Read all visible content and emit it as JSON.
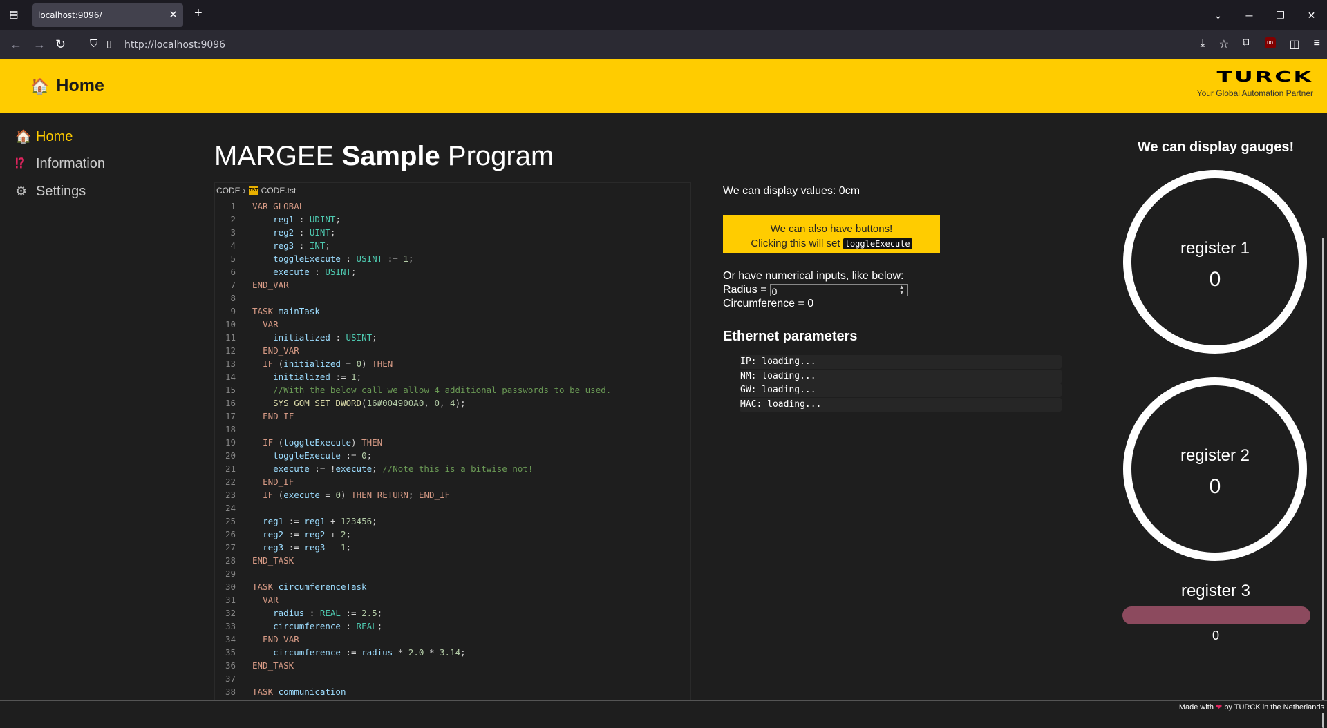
{
  "browser": {
    "tab_title": "localhost:9096/",
    "tab_close": "✕",
    "new_tab": "+",
    "url": "http://localhost:9096"
  },
  "header": {
    "title": "Home",
    "logo_text": "TURCK",
    "logo_tagline": "Your Global Automation Partner"
  },
  "sidebar": {
    "items": [
      {
        "label": "Home",
        "icon": "house-icon",
        "active": true
      },
      {
        "label": "Information",
        "icon": "exclamation-question-icon",
        "active": false
      },
      {
        "label": "Settings",
        "icon": "gear-icon",
        "active": false
      }
    ]
  },
  "page": {
    "title_part1": "MARGEE ",
    "title_bold": "Sample",
    "title_part2": " Program"
  },
  "code": {
    "breadcrumb_folder": "CODE",
    "breadcrumb_file": "CODE.tst",
    "file_icon_text": "TST",
    "lines": [
      "VAR_GLOBAL",
      "    reg1 : UDINT;",
      "    reg2 : UINT;",
      "    reg3 : INT;",
      "    toggleExecute : USINT := 1;",
      "    execute : USINT;",
      "END_VAR",
      "",
      "TASK mainTask",
      "  VAR",
      "    initialized : USINT;",
      "  END_VAR",
      "  IF (initialized = 0) THEN",
      "    initialized := 1;",
      "    //With the below call we allow 4 additional passwords to be used.",
      "    SYS_GOM_SET_DWORD(16#004900A0, 0, 4);",
      "  END_IF",
      "",
      "  IF (toggleExecute) THEN",
      "    toggleExecute := 0;",
      "    execute := !execute; //Note this is a bitwise not!",
      "  END_IF",
      "  IF (execute = 0) THEN RETURN; END_IF",
      "",
      "  reg1 := reg1 + 123456;",
      "  reg2 := reg2 + 2;",
      "  reg3 := reg3 - 1;",
      "END_TASK",
      "",
      "TASK circumferenceTask",
      "  VAR",
      "    radius : REAL := 2.5;",
      "    circumference : REAL;",
      "  END_VAR",
      "    circumference := radius * 2.0 * 3.14;",
      "END_TASK",
      "",
      "TASK communication"
    ]
  },
  "values": {
    "display_text": "We can display values: 0cm",
    "button_line1": "We can also have buttons!",
    "button_line2": "Clicking this will set ",
    "button_code": "toggleExecute",
    "inputs_intro": "Or have numerical inputs, like below:",
    "radius_label": "Radius =",
    "radius_value": "0",
    "circumference_text": "Circumference = 0"
  },
  "ethernet": {
    "title": "Ethernet parameters",
    "rows": [
      "IP: loading...",
      "NM: loading...",
      "GW: loading...",
      "MAC: loading..."
    ]
  },
  "gauges": {
    "title": "We can display gauges!",
    "register1_label": "register 1",
    "register1_value": "0",
    "register2_label": "register 2",
    "register2_value": "0",
    "register3_label": "register 3",
    "register3_value": "0",
    "bar_color": "#8c4a5e"
  },
  "footer": {
    "text_before": "Made with ",
    "heart": "❤",
    "text_after": " by TURCK in the Netherlands"
  },
  "colors": {
    "accent": "#ffcc00",
    "background": "#1e1e1e"
  }
}
